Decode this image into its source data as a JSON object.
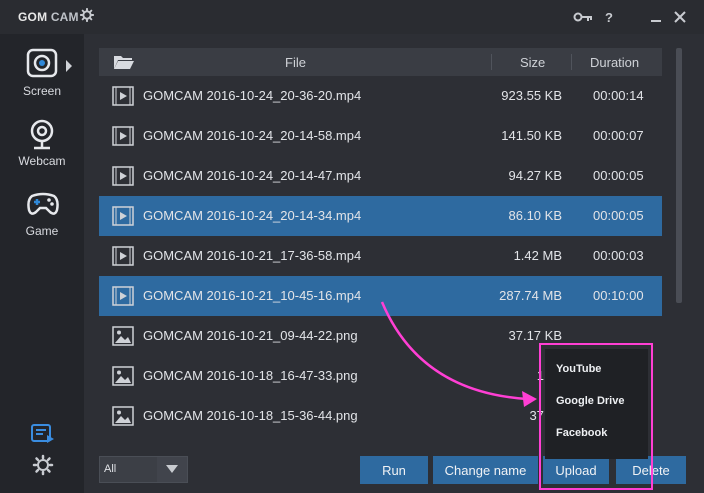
{
  "app": {
    "brand_main": "GOM",
    "brand_sub": "CAM"
  },
  "sidebar": {
    "items": [
      {
        "label": "Screen"
      },
      {
        "label": "Webcam"
      },
      {
        "label": "Game"
      }
    ]
  },
  "table": {
    "columns": [
      "File",
      "Size",
      "Duration"
    ],
    "rows": [
      {
        "name": "GOMCAM 2016-10-24_20-36-20.mp4",
        "size": "923.55 KB",
        "duration": "00:00:14",
        "type": "video",
        "selected": false
      },
      {
        "name": "GOMCAM 2016-10-24_20-14-58.mp4",
        "size": "141.50 KB",
        "duration": "00:00:07",
        "type": "video",
        "selected": false
      },
      {
        "name": "GOMCAM 2016-10-24_20-14-47.mp4",
        "size": "94.27 KB",
        "duration": "00:00:05",
        "type": "video",
        "selected": false
      },
      {
        "name": "GOMCAM 2016-10-24_20-14-34.mp4",
        "size": "86.10 KB",
        "duration": "00:00:05",
        "type": "video",
        "selected": true
      },
      {
        "name": "GOMCAM 2016-10-21_17-36-58.mp4",
        "size": "1.42 MB",
        "duration": "00:00:03",
        "type": "video",
        "selected": false
      },
      {
        "name": "GOMCAM 2016-10-21_10-45-16.mp4",
        "size": "287.74 MB",
        "duration": "00:10:00",
        "type": "video",
        "selected": true
      },
      {
        "name": "GOMCAM 2016-10-21_09-44-22.png",
        "size": "37.17 KB",
        "duration": "",
        "type": "image",
        "selected": false
      },
      {
        "name": "GOMCAM 2016-10-18_16-47-33.png",
        "size": "1.19",
        "duration": "",
        "type": "image",
        "selected": false
      },
      {
        "name": "GOMCAM 2016-10-18_15-36-44.png",
        "size": "37.45",
        "duration": "",
        "type": "image",
        "selected": false
      }
    ]
  },
  "footer": {
    "filter_value": "All",
    "buttons": {
      "run": "Run",
      "change_name": "Change name",
      "upload": "Upload",
      "delete": "Delete"
    }
  },
  "upload_menu": {
    "items": [
      "YouTube",
      "Google Drive",
      "Facebook"
    ]
  },
  "colors": {
    "accent": "#2e6aa0",
    "highlight": "#ff3fd4",
    "background": "#2b2d33"
  }
}
